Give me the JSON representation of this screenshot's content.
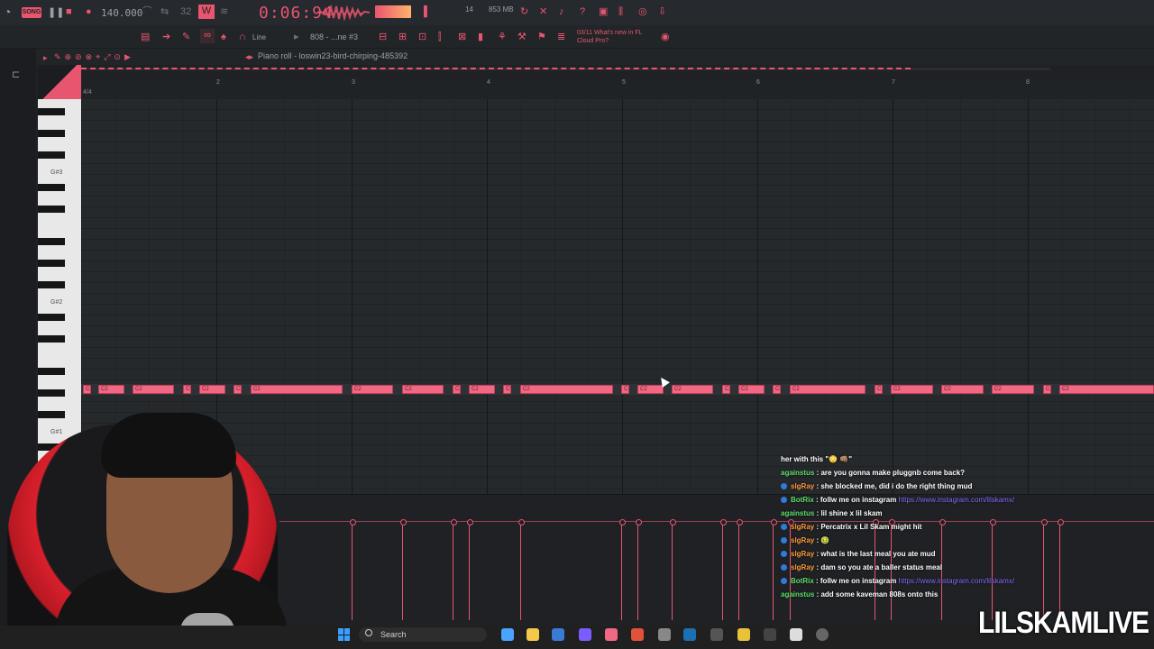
{
  "toolbar": {
    "song_label": "SONG",
    "tempo": "140.000",
    "time": "0:06:94",
    "cpu_count": "14",
    "memory": "853 MB",
    "news_line1": "03/11  What's new in FL",
    "news_line2": "Cloud Pro?",
    "pattern": "808 - ...ne #3",
    "snap": "Line"
  },
  "piano_roll": {
    "title": "Piano roll - loswin23-bird-chirping-485392",
    "time_sig": "4/4",
    "ruler": [
      "2",
      "3",
      "4",
      "5",
      "6",
      "7",
      "8"
    ],
    "key_labels": [
      "G#3",
      "G#2",
      "G#1"
    ],
    "note_label": "C2"
  },
  "chat": [
    {
      "user": "",
      "text": "her with this \"😳 👊🏽\"",
      "color": ""
    },
    {
      "user": "againstus",
      "text": " : are you gonna make pluggnb come back?",
      "color": "green"
    },
    {
      "user": "slgRay",
      "text": " : she blocked me, did i do the right thing mud",
      "color": "orange",
      "badge": true
    },
    {
      "user": "BotRix",
      "text": " : follw me on instagram ",
      "link": "https://www.instagram.com/lilskamx/",
      "color": "green",
      "badge": true
    },
    {
      "user": "againstus",
      "text": " : lil shine x lil skam",
      "color": "green"
    },
    {
      "user": "slgRay",
      "text": " : Percatrix x Lil Skam might hit",
      "color": "orange",
      "badge": true
    },
    {
      "user": "slgRay",
      "text": " : 🤢",
      "color": "orange",
      "badge": true
    },
    {
      "user": "slgRay",
      "text": " : what is the last meal you ate mud",
      "color": "orange",
      "badge": true
    },
    {
      "user": "slgRay",
      "text": " : dam so you ate a baller status meal",
      "color": "orange",
      "badge": true
    },
    {
      "user": "BotRix",
      "text": " : follw me on instagram ",
      "link": "https://www.instagram.com/lilskamx/",
      "color": "green",
      "badge": true
    },
    {
      "user": "againstus",
      "text": " : add some kaveman 808s onto this",
      "color": "green"
    }
  ],
  "taskbar": {
    "search_label": "Search"
  },
  "watermark": "LILSKAMLIVE",
  "colors": {
    "accent": "#e8556f",
    "note_fill": "#f06883",
    "background": "#26292c"
  }
}
